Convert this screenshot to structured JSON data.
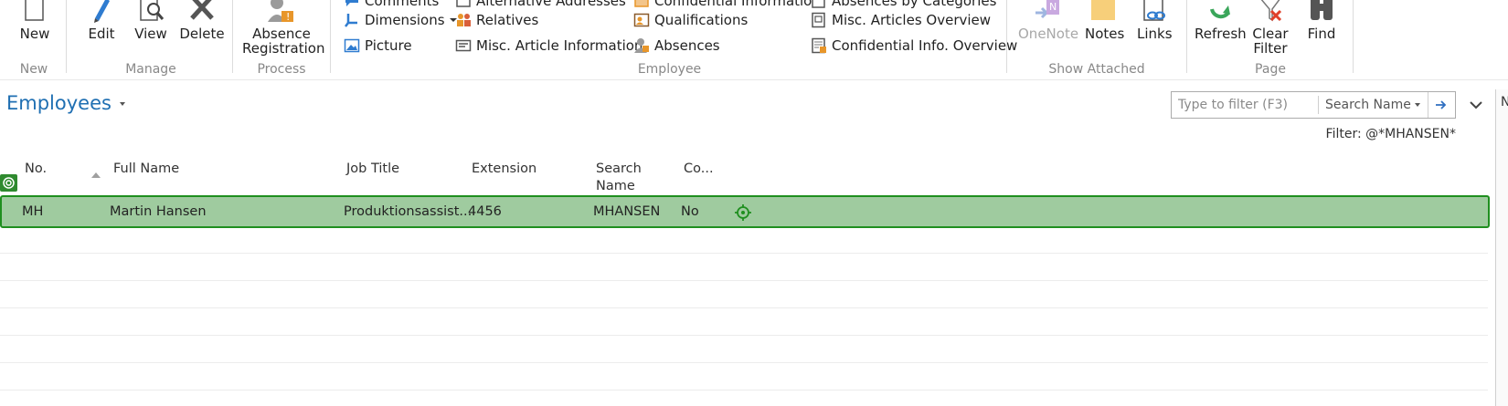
{
  "ribbon": {
    "groups": {
      "new": "New",
      "manage": "Manage",
      "process": "Process",
      "employee": "Employee",
      "show_attached": "Show Attached",
      "page": "Page"
    },
    "new_label": "New",
    "edit_label": "Edit",
    "view_label": "View",
    "delete_label": "Delete",
    "absence_registration_line1": "Absence",
    "absence_registration_line2": "Registration",
    "employee_links": {
      "comments": "Comments",
      "dimensions": "Dimensions",
      "picture": "Picture",
      "alternative_addresses": "Alternative Addresses",
      "relatives": "Relatives",
      "misc_article_information": "Misc. Article Information",
      "confidential_information": "Confidential Information",
      "qualifications": "Qualifications",
      "absences": "Absences",
      "absences_by_categories": "Absences by Categories",
      "misc_articles_overview": "Misc. Articles Overview",
      "confidential_info_overview": "Confidential Info. Overview"
    },
    "onenote_label": "OneNote",
    "notes_label": "Notes",
    "links_label": "Links",
    "refresh_label": "Refresh",
    "clear_filter_line1": "Clear",
    "clear_filter_line2": "Filter",
    "find_label": "Find"
  },
  "page": {
    "title": "Employees",
    "filter_placeholder": "Type to filter (F3)",
    "filter_field": "Search Name",
    "active_filter": "Filter: @*MHANSEN*",
    "right_strip_letter": "N"
  },
  "table": {
    "columns": {
      "no": "No.",
      "full_name": "Full Name",
      "job_title": "Job Title",
      "extension": "Extension",
      "search_name_line1": "Search",
      "search_name_line2": "Name",
      "co": "Co..."
    },
    "rows": [
      {
        "no": "MH",
        "full_name": "Martin Hansen",
        "job_title": "Produktionsassist...",
        "extension": "4456",
        "search_name": "MHANSEN",
        "co": "No"
      }
    ]
  },
  "colors": {
    "accent": "#1f6fb2",
    "selection_fill": "#9fcb9f",
    "selection_border": "#1f8f1f"
  }
}
